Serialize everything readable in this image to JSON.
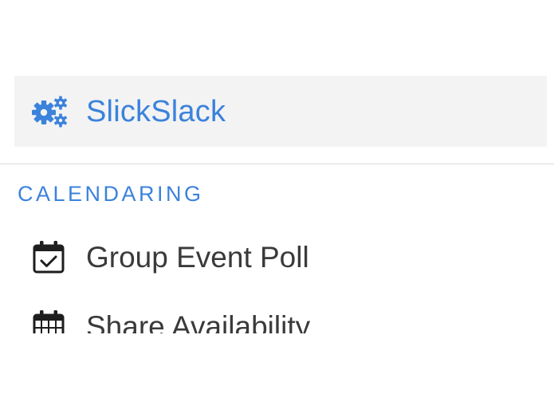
{
  "app": {
    "name": "SlickSlack",
    "icon": "gears-icon",
    "accent_color": "#3b82dc",
    "header_background": "#f3f3f3"
  },
  "section": {
    "heading": "CALENDARING"
  },
  "menu": {
    "items": [
      {
        "label": "Group Event Poll",
        "icon": "calendar-check-icon"
      },
      {
        "label": "Share Availability",
        "icon": "calendar-grid-icon"
      }
    ]
  },
  "colors": {
    "text": "#3a3a3a",
    "divider": "#dcdcdc"
  }
}
